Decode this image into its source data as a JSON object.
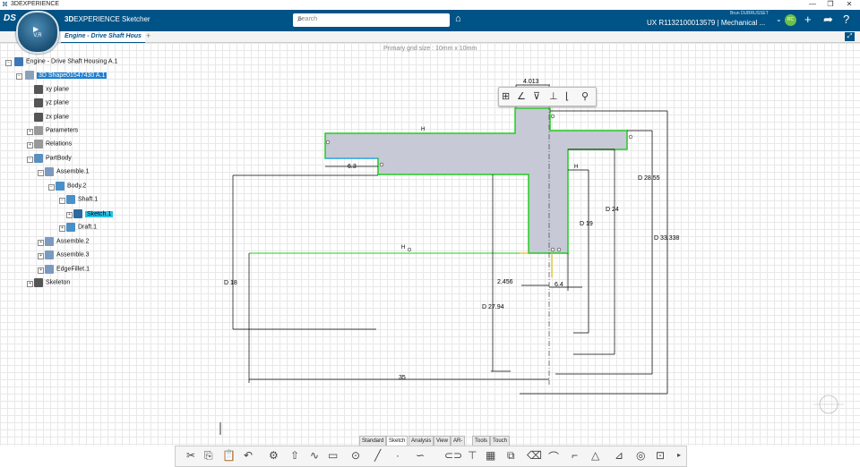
{
  "window": {
    "title": "3DEXPERIENCE"
  },
  "header": {
    "brand_bold": "3D",
    "brand_rest": "EXPERIENCE Sketcher",
    "search_placeholder": "Search",
    "user_name": "Brun DUBRUSSET",
    "project": "UX R1132100013579 | Mechanical ...",
    "avatar_initials": "RC",
    "compass_version": "V,R"
  },
  "tab": {
    "label": "Engine - Drive Shaft Hous"
  },
  "canvas": {
    "grid_info": "Primary grid size : 10mm x 10mm"
  },
  "tree": [
    {
      "label": "Engine - Drive Shaft Housing A.1"
    },
    {
      "label": "3D Shape01547430 A.1"
    },
    {
      "label": "xy plane"
    },
    {
      "label": "yz plane"
    },
    {
      "label": "zx plane"
    },
    {
      "label": "Parameters"
    },
    {
      "label": "Relations"
    },
    {
      "label": "PartBody"
    },
    {
      "label": "Assemble.1"
    },
    {
      "label": "Body.2"
    },
    {
      "label": "Shaft.1"
    },
    {
      "label": "Sketch.1"
    },
    {
      "label": "Draft.1"
    },
    {
      "label": "Assemble.2"
    },
    {
      "label": "Assemble.3"
    },
    {
      "label": "EdgeFillet.1"
    },
    {
      "label": "Skeleton"
    }
  ],
  "dimensions": {
    "d1": "4.013",
    "d2": "6.3",
    "d3": "D 28.55",
    "d4": "D 24",
    "d5": "D 19",
    "d6": "D 33.338",
    "d7": "D 18",
    "d8": "2.456",
    "d9": "6.4",
    "d10": "D 27.94",
    "d11": "35",
    "h1": "H",
    "h2": "H",
    "h3": "H"
  },
  "bottom_tabs": [
    "Standard",
    "Sketch",
    "Analysis",
    "View",
    "AR-VR",
    "Tools",
    "Touch"
  ],
  "colors": {
    "header": "#005386",
    "profile": "#22cc22",
    "fill": "#c7c9d6"
  }
}
